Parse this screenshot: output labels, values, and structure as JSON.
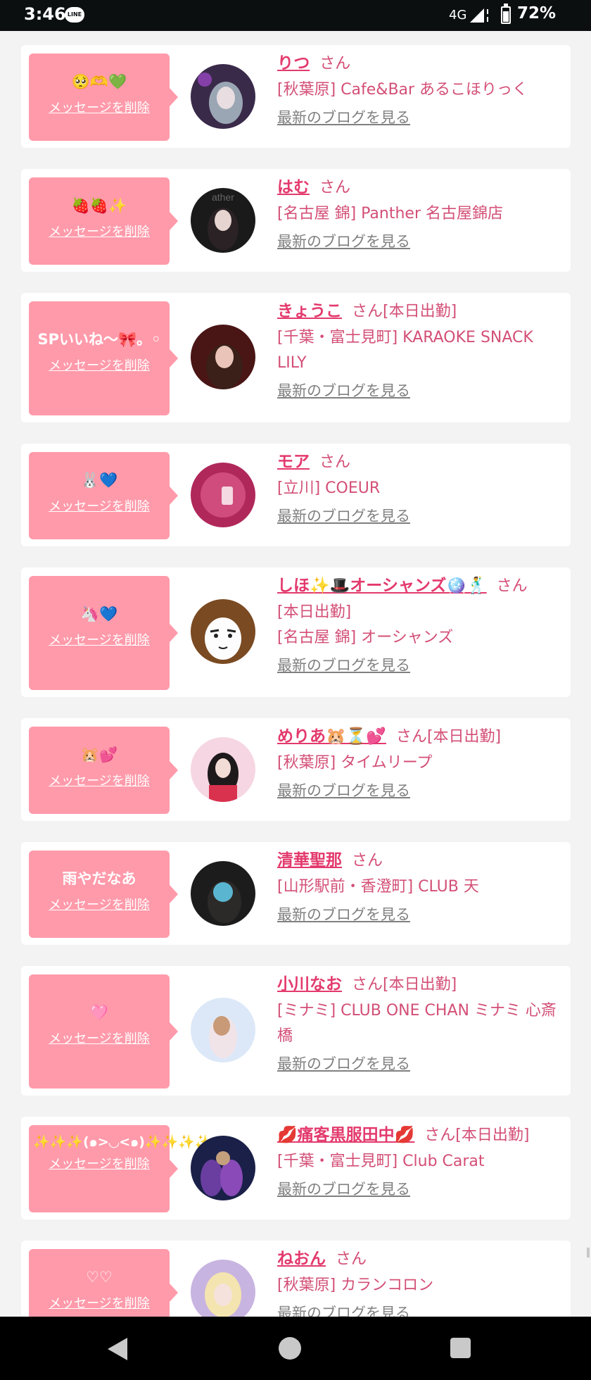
{
  "status_bar": {
    "time": "3:46",
    "line_icon": "LINE",
    "network": "4G",
    "battery": "72%"
  },
  "delete_label": "メッセージを削除",
  "blog_label": "最新のブログを見る",
  "san_label": "さん",
  "cards": [
    {
      "message": "🥺🫶💚",
      "name": "りつ",
      "status": "",
      "shop": "[秋葉原] Cafe&Bar あるこほりっく"
    },
    {
      "message": "🍓🍓✨",
      "name": "はむ",
      "status": "",
      "shop": "[名古屋 錦] Panther 名古屋錦店"
    },
    {
      "message": "SPいいね〜🎀。◦",
      "name": "きょうこ",
      "status": "[本日出勤]",
      "shop": "[千葉・富士見町] KARAOKE SNACK LILY"
    },
    {
      "message": "🐰💙",
      "name": "モア",
      "status": "",
      "shop": "[立川] COEUR"
    },
    {
      "message": "🦄💙",
      "name": "しほ✨🎩オーシャンズ🪩🕺",
      "status": "",
      "status_line": "[本日出勤]",
      "shop": "[名古屋 錦] オーシャンズ"
    },
    {
      "message": "🐹💕",
      "name": "めりあ🐹⏳💕",
      "status": "[本日出勤]",
      "shop": "[秋葉原] タイムリープ"
    },
    {
      "message": "雨やだなあ",
      "name": "清華聖那",
      "status": "",
      "shop": "[山形駅前・香澄町] CLUB 天"
    },
    {
      "message": "🩷",
      "name": "小川なお",
      "status": "[本日出勤]",
      "shop": "[ミナミ] CLUB ONE CHAN ミナミ 心斎橋"
    },
    {
      "message": "✨✨✨(๑>◡<๑)✨✨✨✨",
      "name": "💋痛客黒服田中💋",
      "status": "[本日出勤]",
      "shop": "[千葉・富士見町] Club Carat"
    },
    {
      "message": "♡♡",
      "name": "ねおん",
      "status": "",
      "shop": "[秋葉原] カランコロン"
    }
  ],
  "colors": {
    "bubble": "#ff9aaa",
    "name": "#e33a6d",
    "shop": "#d34f76",
    "blog": "#808080"
  },
  "icons": {
    "nav_back": "back-triangle-icon",
    "nav_home": "home-circle-icon",
    "nav_recent": "recent-square-icon"
  }
}
